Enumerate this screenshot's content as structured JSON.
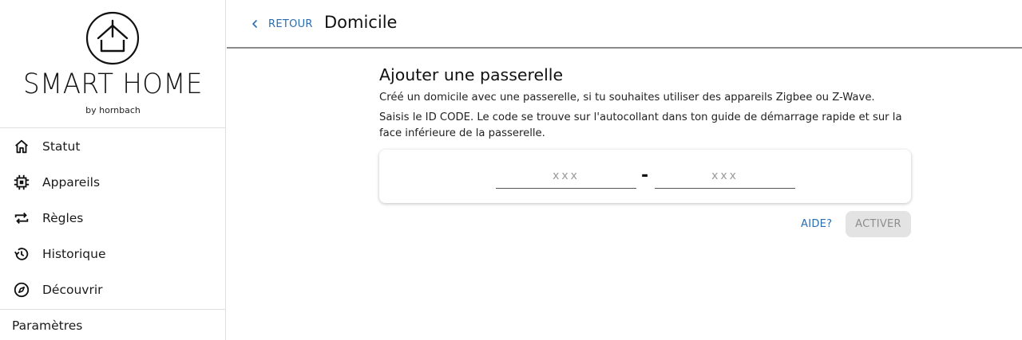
{
  "brand": {
    "title": "SMART HOME",
    "subtitle": "by hornbach",
    "logo_icon": "house-power-icon"
  },
  "sidebar": {
    "items": [
      {
        "label": "Statut",
        "icon": "home-icon"
      },
      {
        "label": "Appareils",
        "icon": "chip-icon"
      },
      {
        "label": "Règles",
        "icon": "repeat-icon"
      },
      {
        "label": "Historique",
        "icon": "history-icon"
      },
      {
        "label": "Découvrir",
        "icon": "compass-icon"
      }
    ],
    "settings_label": "Paramètres"
  },
  "header": {
    "back_label": "RETOUR",
    "title": "Domicile"
  },
  "main": {
    "title": "Ajouter une passerelle",
    "description_1": "Créé un domicile avec une passerelle, si tu souhaites utiliser des appareils Zigbee ou Z-Wave.",
    "description_2": "Saisis le ID CODE. Le code se trouve sur l'autocollant dans ton guide de démarrage rapide et sur la face inférieure de la passerelle.",
    "code": {
      "part1_placeholder": "xxx",
      "part1_value": "",
      "separator": "-",
      "part2_placeholder": "xxx",
      "part2_value": ""
    },
    "help_label": "AIDE?",
    "activate_label": "ACTIVER"
  },
  "colors": {
    "accent": "#2b6cb0",
    "disabled_bg": "#e3e3e3",
    "disabled_text": "#8d8d8d"
  }
}
